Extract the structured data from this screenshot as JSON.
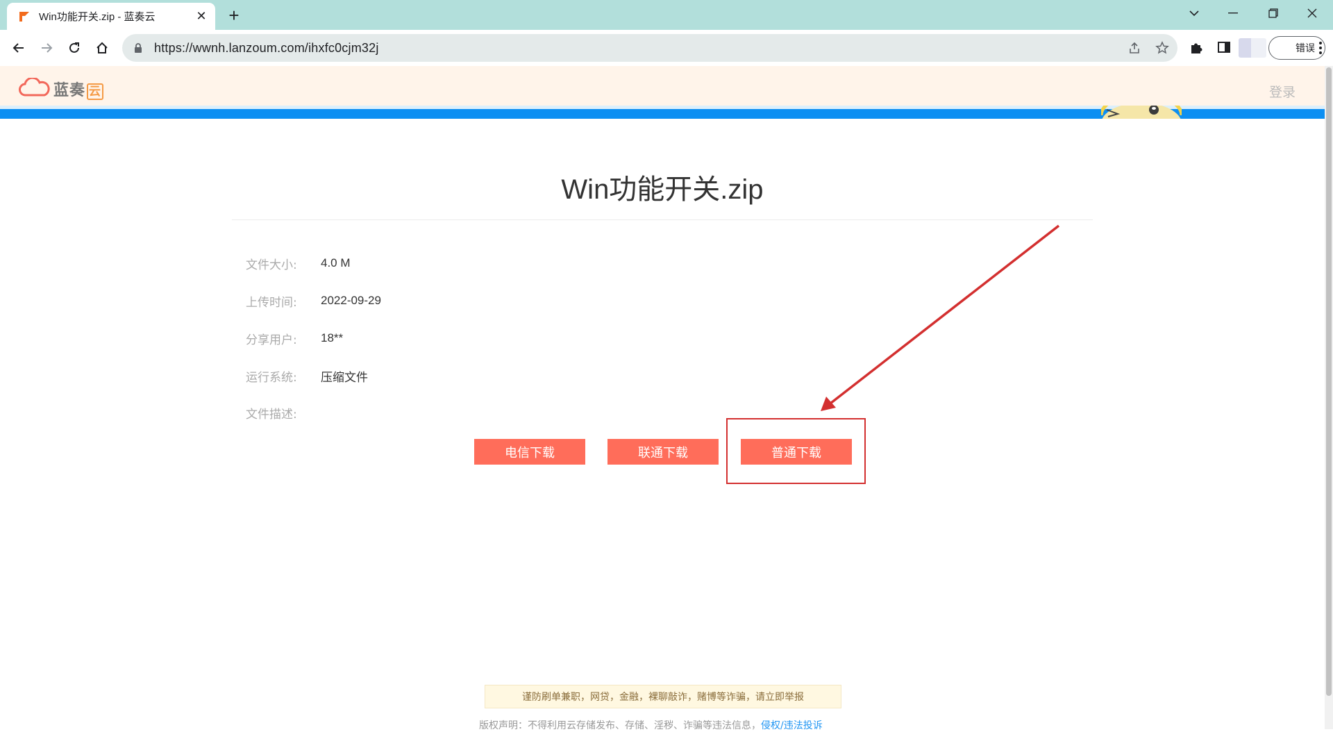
{
  "browser": {
    "tab_title": "Win功能开关.zip - 蓝奏云",
    "url": "https://wwnh.lanzoum.com/ihxfc0cjm32j",
    "error_button": "错误"
  },
  "site": {
    "logo_text": "蓝奏",
    "logo_accent": "云",
    "login": "登录"
  },
  "file": {
    "name": "Win功能开关.zip",
    "info": [
      {
        "label": "文件大小:",
        "value": "4.0 M"
      },
      {
        "label": "上传时间:",
        "value": "2022-09-29"
      },
      {
        "label": "分享用户:",
        "value": "18**"
      },
      {
        "label": "运行系统:",
        "value": "压缩文件"
      },
      {
        "label": "文件描述:",
        "value": ""
      }
    ]
  },
  "downloads": {
    "telecom": "电信下载",
    "unicom": "联通下载",
    "normal": "普通下载"
  },
  "footer": {
    "warning": "谨防刷单兼职，网贷，金融，裸聊敲诈，赌博等诈骗，请立即举报",
    "copyright": "版权声明：不得利用云存储发布、存储、淫秽、诈骗等违法信息，",
    "report_link": "侵权/违法投诉"
  },
  "colors": {
    "tab_strip": "#b2dfdb",
    "header_bg": "#fff4ea",
    "band_blue": "#0d8ff2",
    "button_red": "#ff6d5a",
    "annotation_red": "#d32f2f"
  }
}
